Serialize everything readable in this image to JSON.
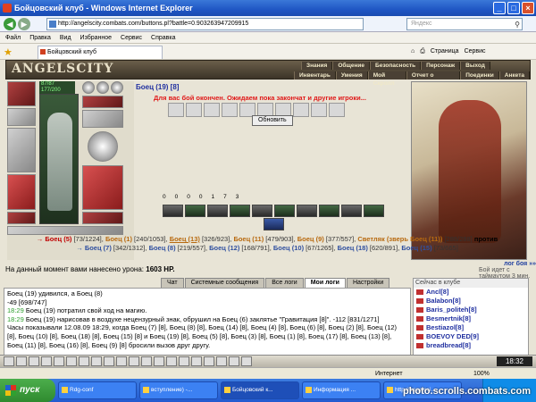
{
  "window": {
    "title": "Бойцовский клуб - Windows Internet Explorer"
  },
  "address": {
    "url": "http://angelscity.combats.com/buttons.pl?battle=0.903263947209915",
    "search_placeholder": "Яндекс"
  },
  "menu": [
    "Файл",
    "Правка",
    "Вид",
    "Избранное",
    "Сервис",
    "Справка"
  ],
  "tab": {
    "label": "Бойцовский клуб"
  },
  "toolbar": {
    "page": "Страница",
    "service": "Сервис"
  },
  "game": {
    "logo": "ANGELSCITY",
    "nav_top": [
      "Знания",
      "Общение",
      "Безопасность",
      "Персонаж",
      "Выход"
    ],
    "nav_bottom": [
      "Инвентарь",
      "Умения",
      "Мой Скролл",
      "Отчет о переводах",
      "Поединки",
      "Анкета"
    ],
    "hp": "87/87",
    "mana": "177/200",
    "opponent_top": "Боец (19) [8]",
    "wait_message": "Для вас бой окончен. Ожидаем пока закончат и другие игроки...",
    "refresh_label": "Обновить",
    "stats": [
      "0",
      "0",
      "0",
      "0",
      "1",
      "7",
      "3"
    ],
    "fighters_line1": [
      {
        "name": "Боец (5)",
        "hp": "[73/1224],",
        "cls": "red"
      },
      {
        "name": "Боец (1)",
        "hp": "[240/1053],",
        "cls": "orange"
      },
      {
        "name": "Боец (13)",
        "hp": "[326/923],",
        "cls": "orange"
      },
      {
        "name": "Боец (11)",
        "hp": "[479/903],",
        "cls": "orange"
      },
      {
        "name": "Боец (9)",
        "hp": "[377/557],",
        "cls": "orange"
      },
      {
        "name": "Светляк (зверь Боец (11))",
        "hp": "[288/288]",
        "cls": "orange"
      }
    ],
    "versus": "против",
    "fighters_line2": [
      {
        "name": "Боец (7)",
        "hp": "[342/1312],",
        "cls": "blue"
      },
      {
        "name": "Боец (8)",
        "hp": "[219/557],",
        "cls": "blue"
      },
      {
        "name": "Боец (12)",
        "hp": "[168/791],",
        "cls": "blue"
      },
      {
        "name": "Боец (10)",
        "hp": "[67/1265],",
        "cls": "blue"
      },
      {
        "name": "Боец (18)",
        "hp": "[620/891],",
        "cls": "blue"
      },
      {
        "name": "Боец (15)",
        "hp": "[73/665]",
        "cls": "blue"
      }
    ],
    "damage_label": "На данный момент вами нанесено урона:",
    "damage_value": "1603 HP.",
    "log_nav": "лог боя »»",
    "log_preview": "Бой идет с таймаутом 3 мин.",
    "chat_tabs": [
      "Чат",
      "Системные сообщения",
      "Все логи",
      "Мои логи",
      "Настройки"
    ],
    "chat_lines": [
      {
        "time": "",
        "text": "Боец (19) удивился, а Боец (8)"
      },
      {
        "time": "",
        "text": "-49 [698/747]"
      },
      {
        "time": "18:29",
        "text": "Боец (19) потратил свой ход на магию."
      },
      {
        "time": "18:29",
        "text": "Боец (19) нарисовав в воздухе нецензурный знак, обрушил на Боец (6) заклятье \"Гравитация [8]\". -112 [831/1271]"
      },
      {
        "time": "",
        "text": "Часы показывали 12.08.09 18:29, когда Боец (7) [8], Боец (8) [8], Боец (14) [8], Боец (4) [8], Боец (6) [8], Боец (2) [8], Боец (12) [8], Боец (10) [8], Боец (18) [8], Боец (15) [8] и Боец (19) [8], Боец (5) [8], Боец (3) [8], Боец (1) [8], Боец (17) [8], Боец (13) [8], Боец (11) [8], Боец (16) [8], Боец (9) [8] бросили вызов друг другу."
      }
    ],
    "userlist_header": "Сейчас в клубе",
    "users": [
      "Ancl[8]",
      "Balabon[8]",
      "Baris_politeh[8]",
      "Besmertnik[8]",
      "Bestiazol[8]",
      "BOEVOY DED[9]",
      "breadbread[8]"
    ],
    "clock": "18:32"
  },
  "status": {
    "internet": "Интернет",
    "zoom": "100%"
  },
  "taskbar": {
    "start": "пуск",
    "items": [
      "Rdg-conf",
      "вступление) -...",
      "Бойцовский к...",
      "Информация ...",
      "http://angelsci..."
    ],
    "watermark": "photo.scrolls.combats.com"
  }
}
